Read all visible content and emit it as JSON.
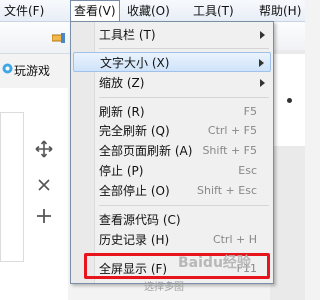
{
  "menubar": {
    "items": [
      {
        "label": "文件(F)"
      },
      {
        "label": "查看(V)"
      },
      {
        "label": "收藏(O)"
      },
      {
        "label": "工具(T)"
      },
      {
        "label": "帮助(H)"
      }
    ]
  },
  "favorites": {
    "game_label": "玩游戏"
  },
  "menu": {
    "items": [
      {
        "label": "工具栏 (T)",
        "shortcut": "",
        "submenu": true
      },
      {
        "label": "文字大小 (X)",
        "shortcut": "",
        "submenu": true
      },
      {
        "label": "缩放 (Z)",
        "shortcut": "",
        "submenu": true
      },
      {
        "label": "刷新 (R)",
        "shortcut": "F5",
        "submenu": false
      },
      {
        "label": "完全刷新 (Q)",
        "shortcut": "Ctrl + F5",
        "submenu": false
      },
      {
        "label": "全部页面刷新 (A)",
        "shortcut": "Shift + F5",
        "submenu": false
      },
      {
        "label": "停止 (P)",
        "shortcut": "Esc",
        "submenu": false
      },
      {
        "label": "全部停止 (O)",
        "shortcut": "Shift + Esc",
        "submenu": false
      },
      {
        "label": "查看源代码 (C)",
        "shortcut": "",
        "submenu": false
      },
      {
        "label": "历史记录 (H)",
        "shortcut": "Ctrl + H",
        "submenu": false
      },
      {
        "label": "全屏显示 (F)",
        "shortcut": "F11",
        "submenu": false
      }
    ]
  },
  "watermark": {
    "text": "Baidu经验",
    "sub": "选择多图"
  },
  "colors": {
    "highlight": "#e8141b",
    "hover": "#cfe3fa",
    "menu_border": "#7a8ea8"
  }
}
